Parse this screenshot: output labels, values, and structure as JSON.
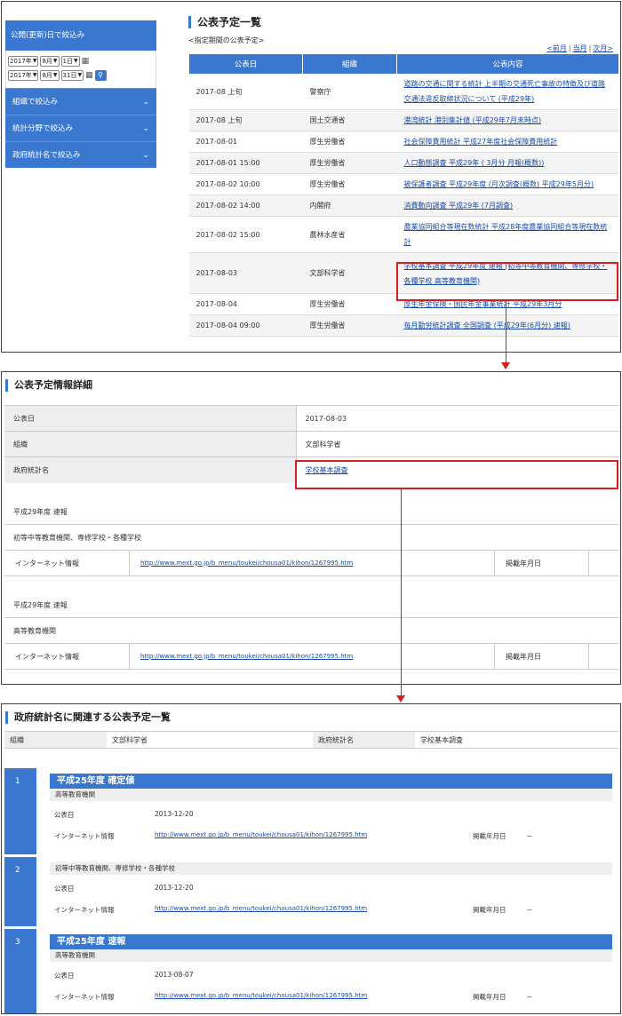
{
  "filter": {
    "header": "公開(更新)日で絞込み",
    "from": {
      "year": "2017年",
      "month": "8月",
      "day": "1日"
    },
    "to": {
      "year": "2017年",
      "month": "8月",
      "day": "31日"
    },
    "accordions": [
      "組織で絞込み",
      "統計分野で絞込み",
      "政府統計名で絞込み"
    ]
  },
  "schedule": {
    "title": "公表予定一覧",
    "subtitle": "<指定期間の公表予定>",
    "pager": {
      "prev": "<前月",
      "current": "当月",
      "next": "次月>"
    },
    "columns": [
      "公表日",
      "組織",
      "公表内容"
    ],
    "rows": [
      {
        "date": "2017-08 上旬",
        "org": "警察庁",
        "content": "道路の交通に関する統計 上半期の交通死亡事故の特徴及び道路交通法違反取締状況について (平成29年)"
      },
      {
        "date": "2017-08 上旬",
        "org": "国土交通省",
        "content": "港湾統計 港別集計値 (平成29年7月末時点)"
      },
      {
        "date": "2017-08-01",
        "org": "厚生労働省",
        "content": "社会保障費用統計 平成27年度社会保障費用統計"
      },
      {
        "date": "2017-08-01 15:00",
        "org": "厚生労働省",
        "content": "人口動態調査 平成29年 ( 3月分 月報(概数))"
      },
      {
        "date": "2017-08-02 10:00",
        "org": "厚生労働省",
        "content": "被保護者調査 平成29年度 (月次調査(概数) 平成29年5月分)"
      },
      {
        "date": "2017-08-02 14:00",
        "org": "内閣府",
        "content": "消費動向調査 平成29年 (7月調査)"
      },
      {
        "date": "2017-08-02 15:00",
        "org": "農林水産省",
        "content": "農業協同組合等現在数統計 平成28年度農業協同組合等現在数統計"
      },
      {
        "date": "2017-08-03",
        "org": "文部科学省",
        "content": "学校基本調査 平成29年度 速報 (初等中等教育機関、専修学校・各種学校 高等教育機関)"
      },
      {
        "date": "2017-08-04",
        "org": "厚生労働省",
        "content": "厚生年金保険・国民年金事業統計 平成29年3月分"
      },
      {
        "date": "2017-08-04 09:00",
        "org": "厚生労働省",
        "content": "毎月勤労統計調査 全国調査 (平成29年(6月分) 速報)"
      }
    ]
  },
  "detail": {
    "title": "公表予定情報詳細",
    "rows": [
      {
        "key": "公表日",
        "value": "2017-08-03"
      },
      {
        "key": "組織",
        "value": "文部科学省"
      },
      {
        "key": "政府統計名",
        "value": "学校基本調査"
      }
    ],
    "groups": [
      {
        "lines": [
          "平成29年度 速報",
          "初等中等教育機関、専修学校・各種学校"
        ],
        "net_label": "インターネット情報",
        "url": "http://www.mext.go.jp/b_menu/toukei/chousa01/kihon/1267995.htm",
        "posted_label": "掲載年月日"
      },
      {
        "lines": [
          "平成29年度 速報",
          "高等教育機関"
        ],
        "net_label": "インターネット情報",
        "url": "http://www.mext.go.jp/b_menu/toukei/chousa01/kihon/1267995.htm",
        "posted_label": "掲載年月日"
      }
    ]
  },
  "related": {
    "title": "政府統計名に関連する公表予定一覧",
    "org_label": "組織",
    "org_value": "文部科学省",
    "stat_label": "政府統計名",
    "stat_value": "学校基本調査",
    "entries": [
      {
        "num": "1",
        "band": "平成25年度 確定値",
        "sub": "高等教育機関",
        "date_label": "公表日",
        "date": "2013-12-20",
        "net_label": "インターネット情報",
        "url": "http://www.mext.go.jp/b_menu/toukei/chousa01/kihon/1267995.htm",
        "posted_label": "掲載年月日",
        "posted": "－"
      },
      {
        "num": "2",
        "band": "",
        "sub": "初等中等教育機関、専修学校・各種学校",
        "date_label": "公表日",
        "date": "2013-12-20",
        "net_label": "インターネット情報",
        "url": "http://www.mext.go.jp/b_menu/toukei/chousa01/kihon/1267995.htm",
        "posted_label": "掲載年月日",
        "posted": "－"
      },
      {
        "num": "3",
        "band": "平成25年度 速報",
        "sub": "高等教育機関",
        "date_label": "公表日",
        "date": "2013-08-07",
        "net_label": "インターネット情報",
        "url": "http://www.mext.go.jp/b_menu/toukei/chousa01/kihon/1267995.htm",
        "posted_label": "掲載年月日",
        "posted": "－"
      }
    ]
  }
}
